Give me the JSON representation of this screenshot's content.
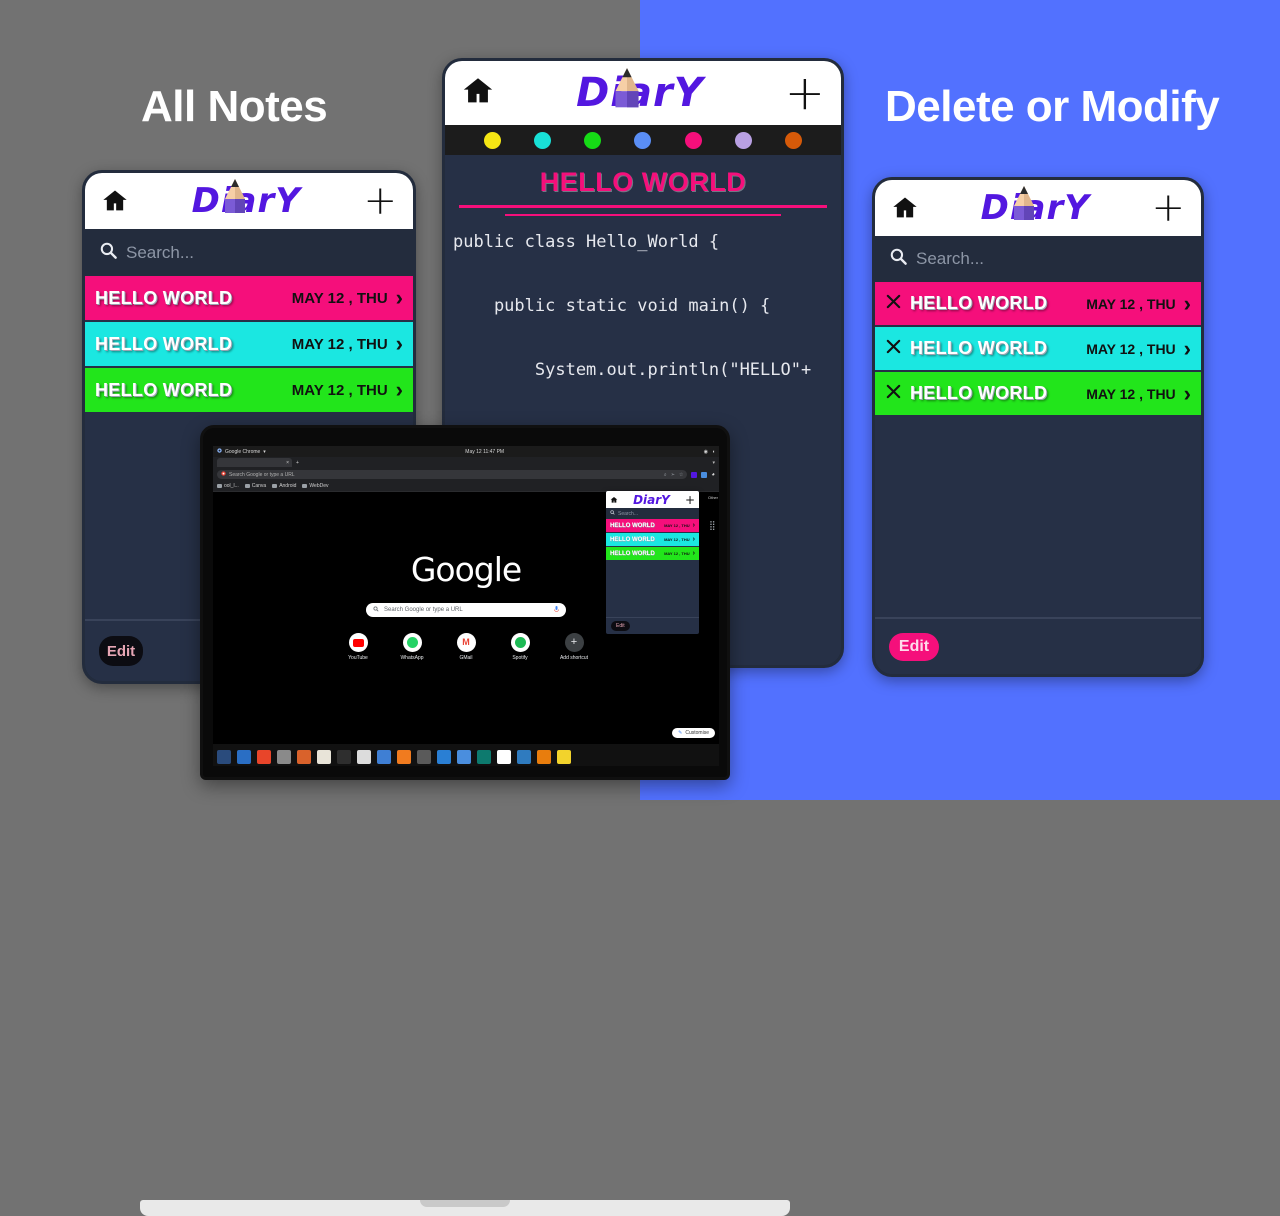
{
  "background": {
    "left_color": "#727272",
    "right_color": "#5271FF"
  },
  "headings": {
    "left": "All Notes",
    "right": "Delete or Modify"
  },
  "app": {
    "brand": "Di",
    "brand_tail": "rY",
    "brand_full": "DiarY",
    "home_icon": "home-icon",
    "add_icon": "plus-icon",
    "search_placeholder": "Search...",
    "search_icon": "search-icon",
    "edit_label": "Edit"
  },
  "phone_left": {
    "notes": [
      {
        "title": "HELLO WORLD",
        "date": "MAY 12 , THU",
        "color": "#F50F7B",
        "chevron": "›"
      },
      {
        "title": "HELLO WORLD",
        "date": "MAY 12 , THU",
        "color": "#1BE7E1",
        "chevron": "›"
      },
      {
        "title": "HELLO WORLD",
        "date": "MAY 12 , THU",
        "color": "#22E51B",
        "chevron": "›"
      }
    ]
  },
  "phone_right": {
    "delete_icon": "close-x-icon",
    "notes": [
      {
        "title": "HELLO WORLD",
        "date": "MAY 12 , THU",
        "color": "#F50F7B",
        "chevron": "›"
      },
      {
        "title": "HELLO WORLD",
        "date": "MAY 12 , THU",
        "color": "#1BE7E1",
        "chevron": "›"
      },
      {
        "title": "HELLO WORLD",
        "date": "MAY 12 , THU",
        "color": "#22E51B",
        "chevron": "›"
      }
    ]
  },
  "phone_center": {
    "palette": [
      "#F5E614",
      "#18E0D6",
      "#16DB16",
      "#5A8EF5",
      "#F50F7B",
      "#B9A0E3",
      "#D65A09"
    ],
    "note_title": "HELLO WORLD",
    "code": "public class Hello_World {\n\n    public static void main() {\n\n        System.out.println(\"HELLO\"+\n\n            \" WORLD\");\n\n    }\n\n}"
  },
  "laptop": {
    "chrome": {
      "app_name": "Google Chrome",
      "clock": "May 12  11:47 PM",
      "tab_title": "",
      "new_tab_label": "+",
      "omnibox_placeholder": "Search Google or type a URL",
      "bookmarks": [
        "ool_l...",
        "Canva",
        "Android",
        "WebDev"
      ],
      "other_bookmarks": "Other",
      "newtab": {
        "logo": "Google",
        "search_placeholder": "Search Google or type a URL",
        "shortcuts": [
          {
            "label": "YouTube",
            "icon": "youtube-icon"
          },
          {
            "label": "WhatsApp",
            "icon": "whatsapp-icon"
          },
          {
            "label": "GMail",
            "icon": "gmail-icon"
          },
          {
            "label": "Spotify",
            "icon": "spotify-icon"
          },
          {
            "label": "Add shortcut",
            "icon": "plus-icon"
          }
        ],
        "customise_label": "Customise"
      },
      "extension_popup": {
        "brand": "DiarY",
        "search_placeholder": "Search...",
        "edit_label": "Edit",
        "notes": [
          {
            "title": "HELLO WORLD",
            "date": "MAY 12 , THU",
            "color": "#F50F7B"
          },
          {
            "title": "HELLO WORLD",
            "date": "MAY 12 , THU",
            "color": "#1BE7E1"
          },
          {
            "title": "HELLO WORLD",
            "date": "MAY 12 , THU",
            "color": "#22E51B"
          }
        ]
      }
    },
    "taskbar_icons": [
      {
        "name": "gimp-icon",
        "color": "#2a4b7c"
      },
      {
        "name": "writer-icon",
        "color": "#2a6ec4"
      },
      {
        "name": "android-studio-icon",
        "color": "#e8452a"
      },
      {
        "name": "database-icon",
        "color": "#8a8a8a"
      },
      {
        "name": "impress-icon",
        "color": "#d9622b"
      },
      {
        "name": "files-icon",
        "color": "#e8e4d8"
      },
      {
        "name": "terminal-icon",
        "color": "#2e2e2e"
      },
      {
        "name": "search-icon",
        "color": "#dcdcdc"
      },
      {
        "name": "text-editor-icon",
        "color": "#3f7fd4"
      },
      {
        "name": "vlc-icon",
        "color": "#f07b1f"
      },
      {
        "name": "settings-icon",
        "color": "#5a5a5a"
      },
      {
        "name": "vscode-icon",
        "color": "#2a7fd4"
      },
      {
        "name": "window-icon",
        "color": "#4a8ede"
      },
      {
        "name": "books-icon",
        "color": "#0d7a6e"
      },
      {
        "name": "chrome-icon",
        "color": "#ffffff"
      },
      {
        "name": "scanner-icon",
        "color": "#2f7bbf"
      },
      {
        "name": "blender-icon",
        "color": "#e87d0d"
      },
      {
        "name": "disk-icon",
        "color": "#f2d32c"
      }
    ]
  }
}
